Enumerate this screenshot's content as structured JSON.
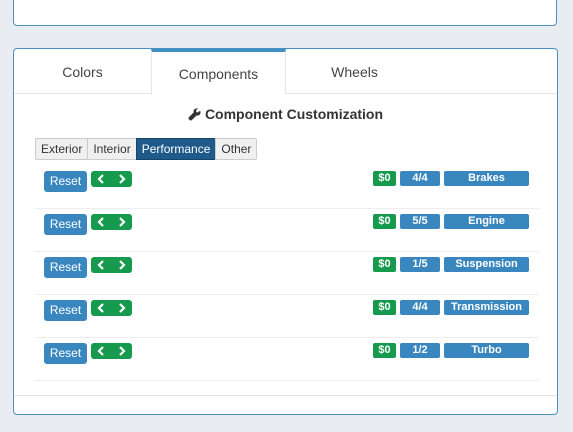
{
  "tabs": [
    {
      "label": "Colors"
    },
    {
      "label": "Components"
    },
    {
      "label": "Wheels"
    }
  ],
  "active_tab": "Components",
  "heading": "Component Customization",
  "heading_icon": "wrench-icon",
  "subtabs": [
    {
      "label": "Exterior"
    },
    {
      "label": "Interior"
    },
    {
      "label": "Performance"
    },
    {
      "label": "Other"
    }
  ],
  "active_subtab": "Performance",
  "rows": [
    {
      "reset": "Reset",
      "price": "$0",
      "count": "4/4",
      "name": "Brakes"
    },
    {
      "reset": "Reset",
      "price": "$0",
      "count": "5/5",
      "name": "Engine"
    },
    {
      "reset": "Reset",
      "price": "$0",
      "count": "1/5",
      "name": "Suspension"
    },
    {
      "reset": "Reset",
      "price": "$0",
      "count": "4/4",
      "name": "Transmission"
    },
    {
      "reset": "Reset",
      "price": "$0",
      "count": "1/2",
      "name": "Turbo"
    }
  ],
  "colors": {
    "accent": "#3a87bf",
    "active_subtab": "#1e5a8a",
    "success": "#169a4e",
    "panel_border": "#4a90c2"
  }
}
